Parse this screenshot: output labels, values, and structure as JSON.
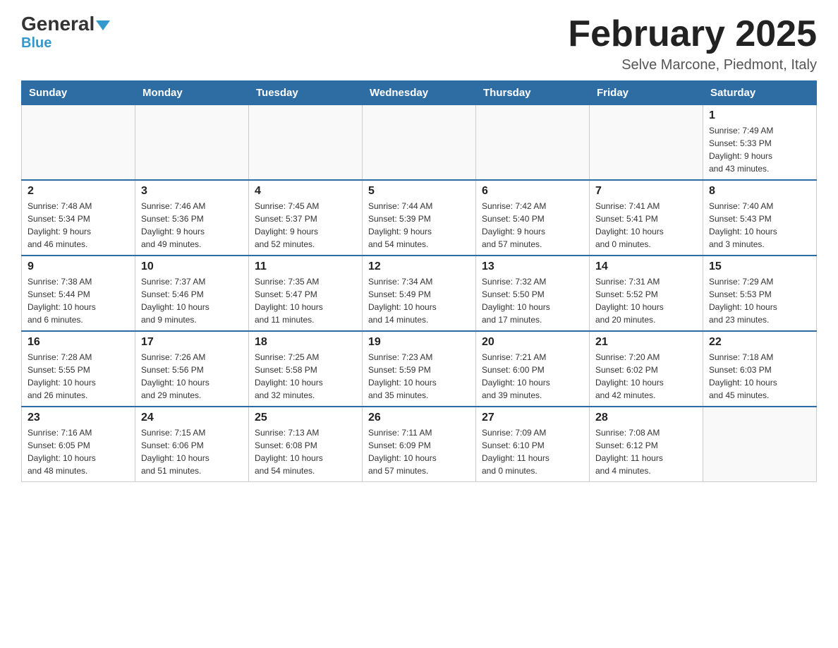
{
  "header": {
    "logo_general": "General",
    "logo_blue": "Blue",
    "month_title": "February 2025",
    "location": "Selve Marcone, Piedmont, Italy"
  },
  "days_of_week": [
    "Sunday",
    "Monday",
    "Tuesday",
    "Wednesday",
    "Thursday",
    "Friday",
    "Saturday"
  ],
  "weeks": [
    [
      {
        "day": "",
        "info": ""
      },
      {
        "day": "",
        "info": ""
      },
      {
        "day": "",
        "info": ""
      },
      {
        "day": "",
        "info": ""
      },
      {
        "day": "",
        "info": ""
      },
      {
        "day": "",
        "info": ""
      },
      {
        "day": "1",
        "info": "Sunrise: 7:49 AM\nSunset: 5:33 PM\nDaylight: 9 hours\nand 43 minutes."
      }
    ],
    [
      {
        "day": "2",
        "info": "Sunrise: 7:48 AM\nSunset: 5:34 PM\nDaylight: 9 hours\nand 46 minutes."
      },
      {
        "day": "3",
        "info": "Sunrise: 7:46 AM\nSunset: 5:36 PM\nDaylight: 9 hours\nand 49 minutes."
      },
      {
        "day": "4",
        "info": "Sunrise: 7:45 AM\nSunset: 5:37 PM\nDaylight: 9 hours\nand 52 minutes."
      },
      {
        "day": "5",
        "info": "Sunrise: 7:44 AM\nSunset: 5:39 PM\nDaylight: 9 hours\nand 54 minutes."
      },
      {
        "day": "6",
        "info": "Sunrise: 7:42 AM\nSunset: 5:40 PM\nDaylight: 9 hours\nand 57 minutes."
      },
      {
        "day": "7",
        "info": "Sunrise: 7:41 AM\nSunset: 5:41 PM\nDaylight: 10 hours\nand 0 minutes."
      },
      {
        "day": "8",
        "info": "Sunrise: 7:40 AM\nSunset: 5:43 PM\nDaylight: 10 hours\nand 3 minutes."
      }
    ],
    [
      {
        "day": "9",
        "info": "Sunrise: 7:38 AM\nSunset: 5:44 PM\nDaylight: 10 hours\nand 6 minutes."
      },
      {
        "day": "10",
        "info": "Sunrise: 7:37 AM\nSunset: 5:46 PM\nDaylight: 10 hours\nand 9 minutes."
      },
      {
        "day": "11",
        "info": "Sunrise: 7:35 AM\nSunset: 5:47 PM\nDaylight: 10 hours\nand 11 minutes."
      },
      {
        "day": "12",
        "info": "Sunrise: 7:34 AM\nSunset: 5:49 PM\nDaylight: 10 hours\nand 14 minutes."
      },
      {
        "day": "13",
        "info": "Sunrise: 7:32 AM\nSunset: 5:50 PM\nDaylight: 10 hours\nand 17 minutes."
      },
      {
        "day": "14",
        "info": "Sunrise: 7:31 AM\nSunset: 5:52 PM\nDaylight: 10 hours\nand 20 minutes."
      },
      {
        "day": "15",
        "info": "Sunrise: 7:29 AM\nSunset: 5:53 PM\nDaylight: 10 hours\nand 23 minutes."
      }
    ],
    [
      {
        "day": "16",
        "info": "Sunrise: 7:28 AM\nSunset: 5:55 PM\nDaylight: 10 hours\nand 26 minutes."
      },
      {
        "day": "17",
        "info": "Sunrise: 7:26 AM\nSunset: 5:56 PM\nDaylight: 10 hours\nand 29 minutes."
      },
      {
        "day": "18",
        "info": "Sunrise: 7:25 AM\nSunset: 5:58 PM\nDaylight: 10 hours\nand 32 minutes."
      },
      {
        "day": "19",
        "info": "Sunrise: 7:23 AM\nSunset: 5:59 PM\nDaylight: 10 hours\nand 35 minutes."
      },
      {
        "day": "20",
        "info": "Sunrise: 7:21 AM\nSunset: 6:00 PM\nDaylight: 10 hours\nand 39 minutes."
      },
      {
        "day": "21",
        "info": "Sunrise: 7:20 AM\nSunset: 6:02 PM\nDaylight: 10 hours\nand 42 minutes."
      },
      {
        "day": "22",
        "info": "Sunrise: 7:18 AM\nSunset: 6:03 PM\nDaylight: 10 hours\nand 45 minutes."
      }
    ],
    [
      {
        "day": "23",
        "info": "Sunrise: 7:16 AM\nSunset: 6:05 PM\nDaylight: 10 hours\nand 48 minutes."
      },
      {
        "day": "24",
        "info": "Sunrise: 7:15 AM\nSunset: 6:06 PM\nDaylight: 10 hours\nand 51 minutes."
      },
      {
        "day": "25",
        "info": "Sunrise: 7:13 AM\nSunset: 6:08 PM\nDaylight: 10 hours\nand 54 minutes."
      },
      {
        "day": "26",
        "info": "Sunrise: 7:11 AM\nSunset: 6:09 PM\nDaylight: 10 hours\nand 57 minutes."
      },
      {
        "day": "27",
        "info": "Sunrise: 7:09 AM\nSunset: 6:10 PM\nDaylight: 11 hours\nand 0 minutes."
      },
      {
        "day": "28",
        "info": "Sunrise: 7:08 AM\nSunset: 6:12 PM\nDaylight: 11 hours\nand 4 minutes."
      },
      {
        "day": "",
        "info": ""
      }
    ]
  ]
}
